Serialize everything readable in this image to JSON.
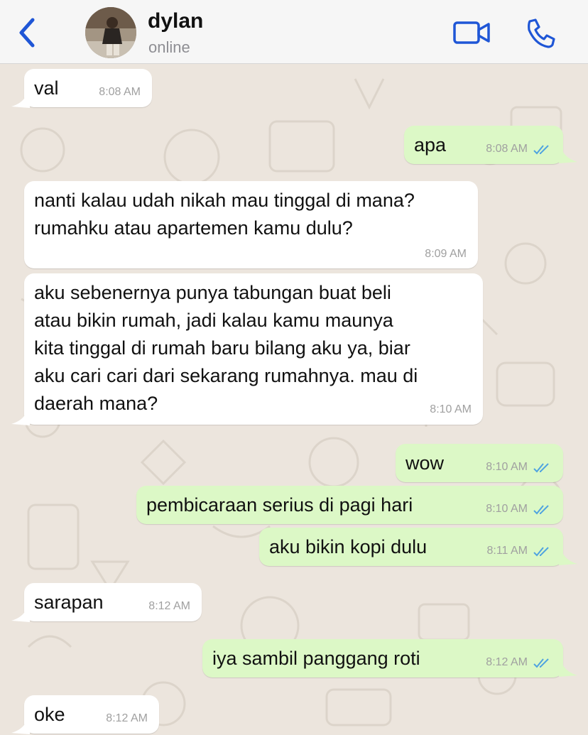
{
  "header": {
    "contact_name": "dylan",
    "status": "online",
    "accent_color": "#1f56d6"
  },
  "messages": [
    {
      "dir": "in",
      "text": "val",
      "time": "8:08 AM"
    },
    {
      "dir": "out",
      "text": "apa",
      "time": "8:08 AM",
      "read": true
    },
    {
      "dir": "in",
      "text": "nanti kalau udah nikah mau tinggal di mana?\nrumahku atau apartemen kamu dulu?",
      "time": "8:09 AM"
    },
    {
      "dir": "in",
      "text": "aku sebenernya punya tabungan buat beli\natau bikin rumah, jadi kalau kamu maunya\nkita tinggal di rumah baru bilang aku ya, biar\naku cari cari dari sekarang rumahnya. mau di\ndaerah mana?",
      "time": "8:10 AM"
    },
    {
      "dir": "out",
      "text": "wow",
      "time": "8:10 AM",
      "read": true
    },
    {
      "dir": "out",
      "text": "pembicaraan serius di pagi hari",
      "time": "8:10 AM",
      "read": true
    },
    {
      "dir": "out",
      "text": "aku bikin kopi dulu",
      "time": "8:11 AM",
      "read": true
    },
    {
      "dir": "in",
      "text": "sarapan",
      "time": "8:12 AM"
    },
    {
      "dir": "out",
      "text": "iya sambil panggang roti",
      "time": "8:12 AM",
      "read": true
    },
    {
      "dir": "in",
      "text": "oke",
      "time": "8:12 AM"
    }
  ]
}
